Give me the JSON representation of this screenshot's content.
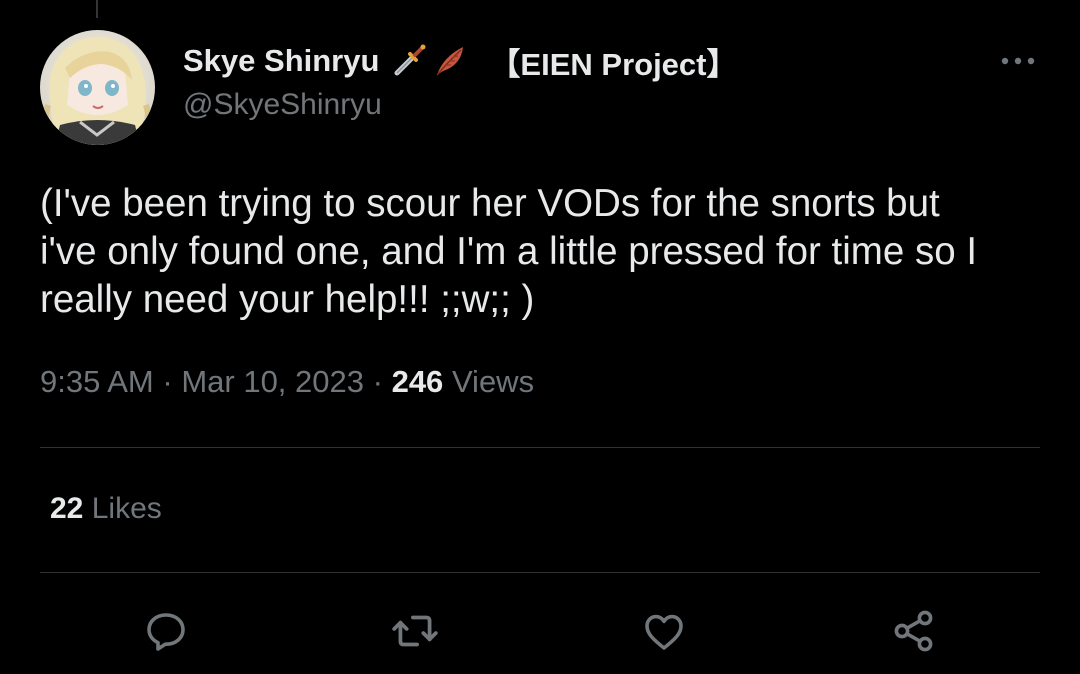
{
  "tweet": {
    "author": {
      "display_name": "Skye Shinryu",
      "name_suffix": "【EIEN Project】",
      "handle": "@SkyeShinryu",
      "name_emoji": [
        "dagger-emoji",
        "feather-emoji"
      ]
    },
    "text": "(I've been trying to scour her VODs for the snorts but\ni've only found one, and I'm a little pressed for time so I\nreally need your help!!! ;;w;; )",
    "time": "9:35 AM",
    "separator": "·",
    "date": "Mar 10, 2023",
    "views_count": "246",
    "views_label": "Views",
    "likes_count": "22",
    "likes_label": "Likes"
  },
  "actions": [
    {
      "name": "reply",
      "icon": "reply-icon"
    },
    {
      "name": "retweet",
      "icon": "retweet-icon"
    },
    {
      "name": "like",
      "icon": "heart-icon"
    },
    {
      "name": "share",
      "icon": "share-icon"
    }
  ],
  "colors": {
    "background": "#000000",
    "primary_text": "#e7e9ea",
    "secondary_text": "#71767b",
    "divider": "#2f3336"
  }
}
